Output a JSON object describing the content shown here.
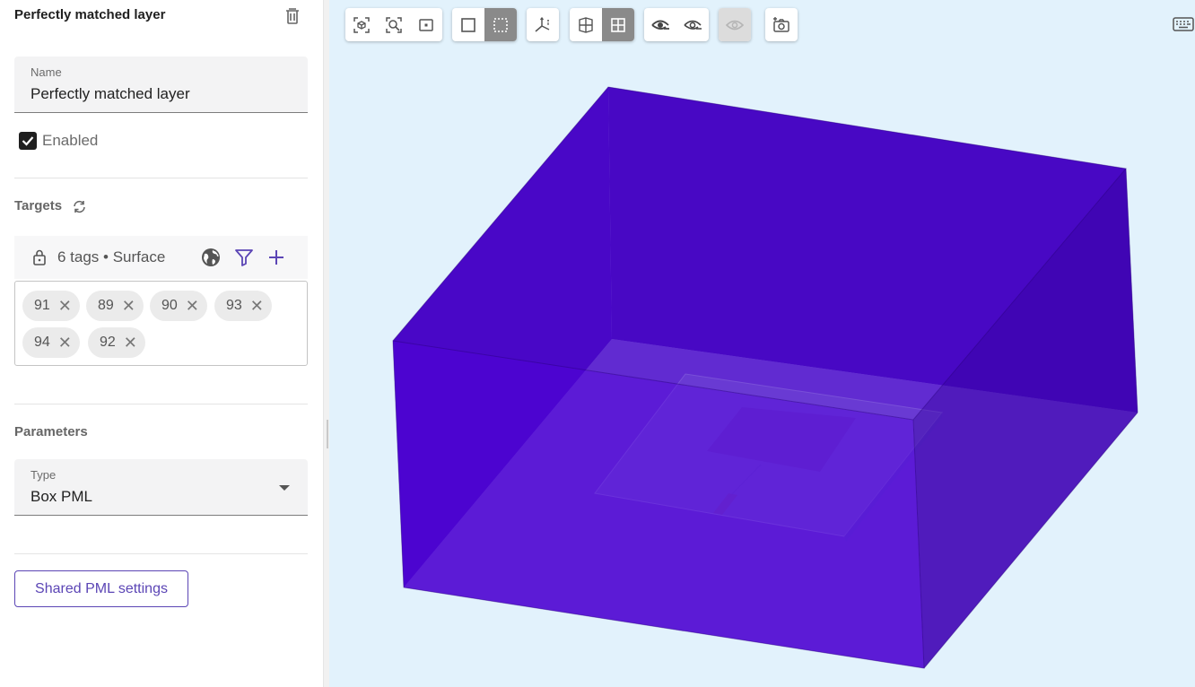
{
  "panel": {
    "title": "Perfectly matched layer",
    "name_field": {
      "label": "Name",
      "value": "Perfectly matched layer"
    },
    "enabled": {
      "label": "Enabled",
      "checked": true
    },
    "targets": {
      "title": "Targets",
      "summary": "6 tags • Surface",
      "chips": [
        "91",
        "89",
        "90",
        "93",
        "94",
        "92"
      ]
    },
    "parameters": {
      "title": "Parameters",
      "type_field": {
        "label": "Type",
        "value": "Box PML"
      }
    },
    "shared_button": "Shared PML settings"
  },
  "toolbar": {
    "groups": [
      [
        "zoom-fit-icon",
        "zoom-selection-icon",
        "zoom-window-icon"
      ],
      [
        "box-select-icon",
        "dashed-select-icon"
      ],
      [
        "axes-icon"
      ],
      [
        "section-view-icon",
        "grid-view-icon"
      ],
      [
        "hide-icon",
        "show-icon"
      ],
      [
        "isolate-icon"
      ],
      [
        "screenshot-icon"
      ]
    ],
    "active": [
      "dashed-select-icon",
      "grid-view-icon"
    ],
    "disabled": [
      "isolate-icon"
    ]
  },
  "colors": {
    "accent": "#5b45b5",
    "viewport_bg": "#e2f2fc",
    "pml_box": "#4a00d0",
    "substrate": "#8d7fd8"
  }
}
